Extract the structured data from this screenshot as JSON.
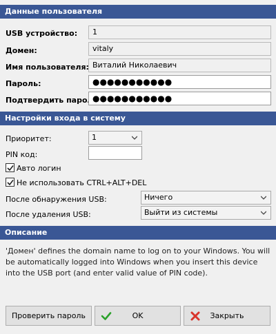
{
  "user_section": {
    "title": "Данные пользователя",
    "usb_label": "USB устройство:",
    "usb_value": "1",
    "domain_label": "Домен:",
    "domain_value": "vitaly",
    "username_label": "Имя пользователя:",
    "username_value": "Виталий Николаевич",
    "password_label": "Пароль:",
    "password_value": "●●●●●●●●●●●",
    "confirm_label": "Подтвердить пароль:",
    "confirm_value": "●●●●●●●●●●●"
  },
  "login_section": {
    "title": "Настройки входа в систему",
    "priority_label": "Приоритет:",
    "priority_value": "1",
    "pin_label": "PIN код:",
    "pin_value": "",
    "autologin_label": "Авто логин",
    "autologin_checked": true,
    "no_ctrl_alt_del_label": "Не использовать CTRL+ALT+DEL",
    "no_ctrl_alt_del_checked": true,
    "on_detect_label": "После обнаружения USB:",
    "on_detect_value": "Ничего",
    "on_remove_label": "После удаления USB:",
    "on_remove_value": "Выйти из системы"
  },
  "description_section": {
    "title": "Описание",
    "text": "'Домен' defines the domain name to log on to your Windows. You will be automatically logged into Windows when you insert this device into the USB port (and enter valid value of PIN code)."
  },
  "buttons": {
    "check_password": "Проверить пароль",
    "ok": "OK",
    "close": "Закрыть"
  },
  "colors": {
    "section_header": "#3a5795",
    "ok_icon": "#2aa12a",
    "close_icon": "#d9342b"
  }
}
